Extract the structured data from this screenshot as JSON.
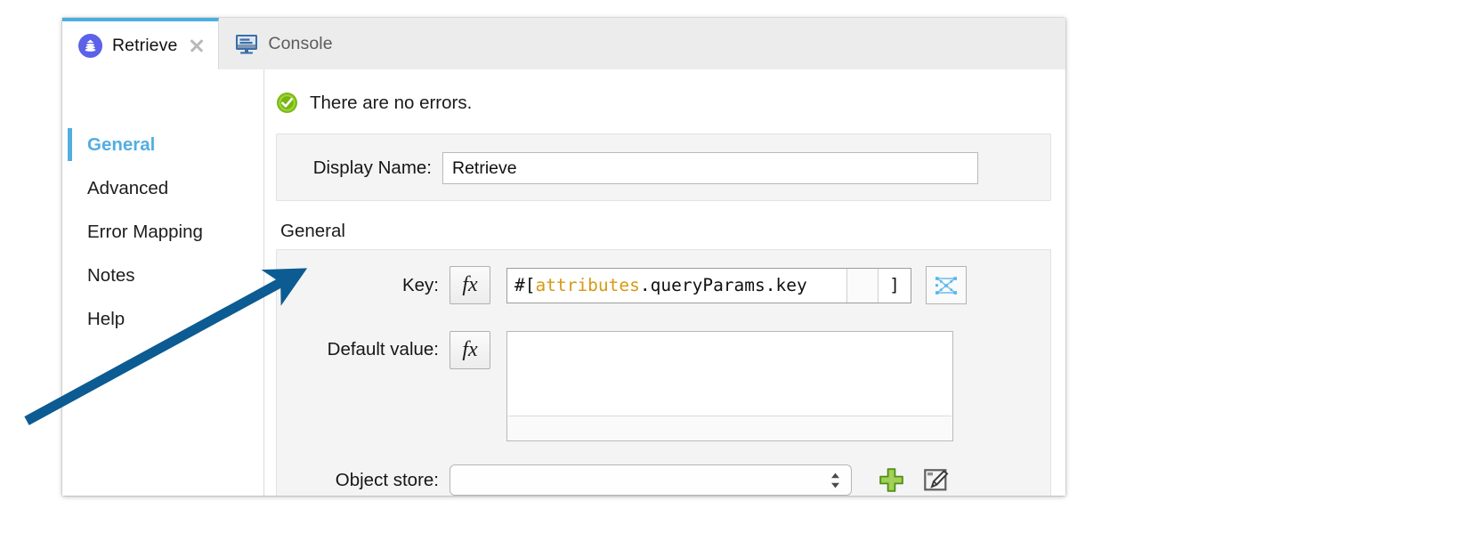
{
  "window": {
    "tabs": [
      {
        "label": "Retrieve",
        "icon": "retrieve-icon",
        "active": true,
        "closable": true
      },
      {
        "label": "Console",
        "icon": "console-icon",
        "active": false,
        "closable": false
      }
    ]
  },
  "sidebar": {
    "items": [
      {
        "label": "General"
      },
      {
        "label": "Advanced"
      },
      {
        "label": "Error Mapping"
      },
      {
        "label": "Notes"
      },
      {
        "label": "Help"
      }
    ],
    "selected": "General"
  },
  "status": {
    "icon": "check-circle-icon",
    "text": "There are no errors."
  },
  "display_name": {
    "label": "Display Name:",
    "value": "Retrieve",
    "placeholder": ""
  },
  "general_section": {
    "title": "General",
    "key": {
      "label": "Key:",
      "fx_label": "fx",
      "expression_prefix": "#[",
      "expression_token": "attributes",
      "expression_rest": ".queryParams.key",
      "expression_suffix": "]",
      "full_value": "#[attributes.queryParams.key]",
      "dataweave_icon": "dataweave-icon"
    },
    "default_value": {
      "label": "Default value:",
      "fx_label": "fx",
      "value": "",
      "placeholder": ""
    },
    "object_store": {
      "label": "Object store:",
      "value": "",
      "placeholder": "",
      "options": [],
      "add_icon": "plus-icon",
      "edit_icon": "edit-icon"
    }
  },
  "annotation": {
    "type": "arrow",
    "color": "#0c5b92",
    "points_to": "Key:"
  },
  "colors": {
    "accent_blue": "#53aee0",
    "tab_icon_purple": "#5b61e8",
    "expression_token": "#d79a16",
    "status_green": "#6aa60c",
    "annotation_blue": "#0c5b92"
  }
}
